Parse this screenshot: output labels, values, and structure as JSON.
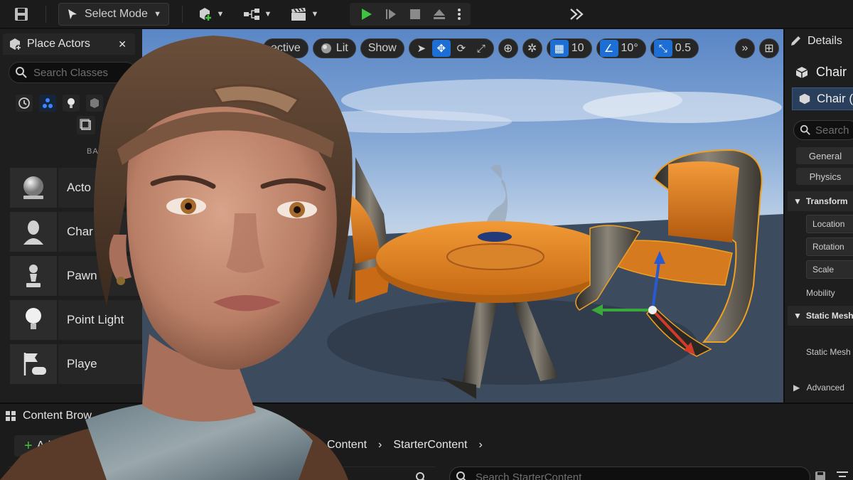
{
  "toolbar": {
    "select_mode_label": "Select Mode",
    "icons": [
      "save-icon",
      "select-mode-icon",
      "add-actor-icon",
      "blueprint-icon",
      "cinematics-icon",
      "play-icon",
      "advance-frame-icon",
      "stop-icon",
      "eject-icon",
      "more-options-icon",
      "expand-toolbar-icon"
    ]
  },
  "place_actors": {
    "tab_title": "Place Actors",
    "search_placeholder": "Search Classes",
    "category_label": "BAS",
    "items": [
      {
        "label": "Acto",
        "icon": "actor-sphere-icon"
      },
      {
        "label": "Char",
        "icon": "character-icon"
      },
      {
        "label": "Pawn",
        "icon": "pawn-icon"
      },
      {
        "label": "Point Light",
        "icon": "point-light-icon"
      },
      {
        "label": "Playe",
        "icon": "player-start-icon"
      }
    ]
  },
  "viewport": {
    "perspective_label": "ective",
    "lit_label": "Lit",
    "show_label": "Show",
    "grid_snap": "10",
    "rotation_snap": "10°",
    "scale_snap": "0.5",
    "colors": {
      "table": "#e08a2a",
      "selection_outline": "#f0a020",
      "gizmo_x": "#d23a2a",
      "gizmo_y": "#3aa83a",
      "gizmo_z": "#2a5ad2"
    }
  },
  "details": {
    "tab_title": "Details",
    "actor_name": "Chair",
    "component_name": "Chair (I",
    "search_placeholder": "Search",
    "filters": [
      "General",
      "Physics"
    ],
    "transform_section": "Transform",
    "location_label": "Location",
    "rotation_label": "Rotation",
    "scale_label": "Scale",
    "mobility_label": "Mobility",
    "static_mesh_section": "Static Mesh",
    "static_mesh_label": "Static Mesh",
    "advanced_label": "Advanced"
  },
  "content_browser": {
    "tab_title": "Content Brow",
    "add_label": "Add",
    "breadcrumbs": [
      "Content",
      "StarterContent"
    ],
    "search_placeholder": "Search StarterContent"
  }
}
